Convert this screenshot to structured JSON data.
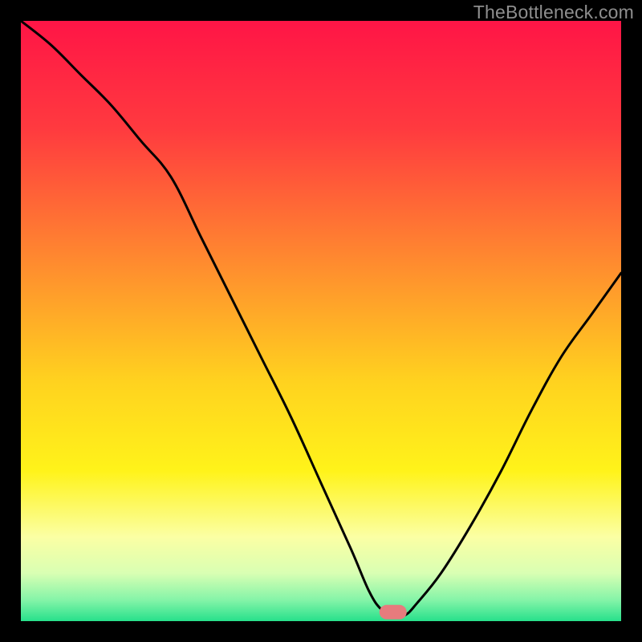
{
  "watermark": "TheBottleneck.com",
  "chart_data": {
    "type": "line",
    "title": "",
    "xlabel": "",
    "ylabel": "",
    "xlim": [
      0,
      100
    ],
    "ylim": [
      0,
      100
    ],
    "grid": false,
    "legend": false,
    "gradient_stops": [
      {
        "offset": 0,
        "color": "#ff1546"
      },
      {
        "offset": 0.18,
        "color": "#ff3a3f"
      },
      {
        "offset": 0.4,
        "color": "#ff8a2f"
      },
      {
        "offset": 0.6,
        "color": "#ffd21f"
      },
      {
        "offset": 0.75,
        "color": "#fff31a"
      },
      {
        "offset": 0.86,
        "color": "#fbffa4"
      },
      {
        "offset": 0.92,
        "color": "#d9ffb3"
      },
      {
        "offset": 0.965,
        "color": "#84f4a8"
      },
      {
        "offset": 1.0,
        "color": "#27e08b"
      }
    ],
    "annotations": [
      {
        "type": "marker",
        "shape": "pill",
        "x": 62,
        "y": 1.5,
        "color": "#e77b7d"
      }
    ],
    "series": [
      {
        "name": "bottleneck-curve",
        "x": [
          0,
          5,
          10,
          15,
          20,
          25,
          30,
          35,
          40,
          45,
          50,
          55,
          58,
          60,
          62,
          64,
          66,
          70,
          75,
          80,
          85,
          90,
          95,
          100
        ],
        "y": [
          100,
          96,
          91,
          86,
          80,
          74,
          64,
          54,
          44,
          34,
          23,
          12,
          5,
          2,
          1,
          1,
          3,
          8,
          16,
          25,
          35,
          44,
          51,
          58
        ]
      }
    ]
  }
}
